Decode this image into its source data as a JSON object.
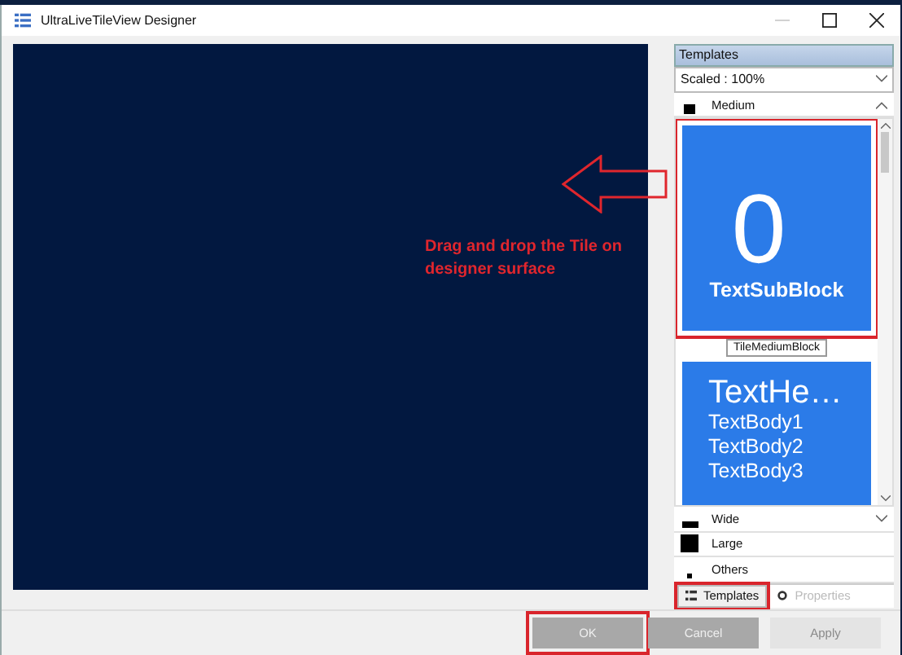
{
  "window": {
    "title": "UltraLiveTileView Designer"
  },
  "annotation": {
    "text": "Drag and drop the Tile on designer surface"
  },
  "panel": {
    "title": "Templates",
    "scale": "Scaled : 100%",
    "sections": [
      {
        "label": "Medium",
        "kind": "medium",
        "expanded": true,
        "tiles": [
          {
            "kind": "number",
            "big": "0",
            "lines": [
              "TextSubBlock"
            ],
            "caption": "TileMediumBlock",
            "highlighted": true
          },
          {
            "kind": "text",
            "big": "TextHe…",
            "lines": [
              "TextBody1",
              "TextBody2",
              "TextBody3"
            ],
            "highlighted": false
          }
        ]
      },
      {
        "label": "Wide",
        "kind": "wide",
        "expanded": false
      },
      {
        "label": "Large",
        "kind": "large",
        "expanded": false
      },
      {
        "label": "Others",
        "kind": "others",
        "expanded": false
      }
    ],
    "tabs": [
      {
        "label": "Templates",
        "selected": true,
        "highlighted": true
      },
      {
        "label": "Properties",
        "selected": false,
        "highlighted": false
      }
    ]
  },
  "buttons": [
    {
      "label": "OK",
      "disabled": false,
      "highlighted": true
    },
    {
      "label": "Cancel",
      "disabled": false,
      "highlighted": false
    },
    {
      "label": "Apply",
      "disabled": true,
      "highlighted": false
    }
  ]
}
